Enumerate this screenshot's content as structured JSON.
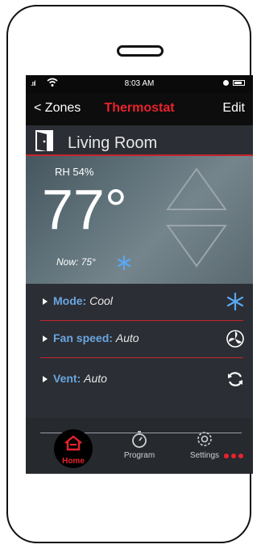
{
  "status_bar": {
    "time": "8:03 AM"
  },
  "nav": {
    "back_label": "Zones",
    "title": "Thermostat",
    "edit_label": "Edit"
  },
  "room": {
    "name": "Living Room"
  },
  "climate": {
    "humidity": "RH 54%",
    "setpoint": "77°",
    "current": "Now: 75°"
  },
  "settings": {
    "mode": {
      "key": "Mode:",
      "value": "Cool",
      "icon": "snowflake-icon"
    },
    "fan": {
      "key": "Fan speed:",
      "value": "Auto",
      "icon": "fan-icon"
    },
    "vent": {
      "key": "Vent:",
      "value": "Auto",
      "icon": "refresh-icon"
    }
  },
  "tabs": {
    "home": "Home",
    "program": "Program",
    "settings": "Settings"
  },
  "colors": {
    "accent_red": "#e8232c",
    "label_blue": "#6aa6e0",
    "snowflake_blue": "#59a8f0"
  }
}
